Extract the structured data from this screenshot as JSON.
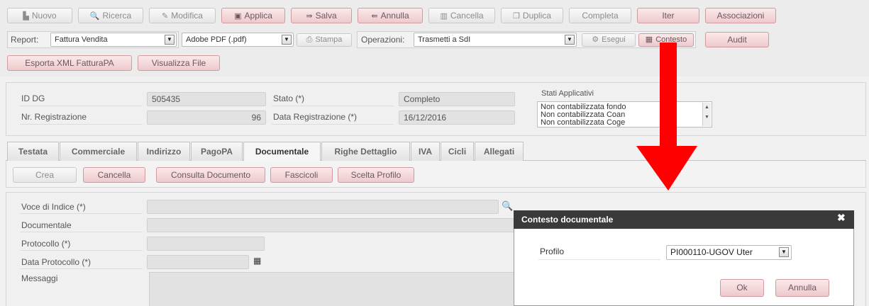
{
  "toolbar": {
    "nuovo": "Nuovo",
    "ricerca": "Ricerca",
    "modifica": "Modifica",
    "applica": "Applica",
    "salva": "Salva",
    "annulla": "Annulla",
    "cancella": "Cancella",
    "duplica": "Duplica",
    "completa": "Completa",
    "iter": "Iter",
    "associazioni": "Associazioni"
  },
  "report_bar": {
    "report_label": "Report:",
    "report_value": "Fattura Vendita",
    "format_value": "Adobe PDF (.pdf)",
    "stampa": "Stampa",
    "operazioni_label": "Operazioni:",
    "operazioni_value": "Trasmetti a SdI",
    "esegui": "Esegui",
    "contesto": "Contesto",
    "audit": "Audit"
  },
  "secondary_bar": {
    "esporta": "Esporta XML FatturaPA",
    "visualizza": "Visualizza File"
  },
  "header_form": {
    "id_dg_label": "ID DG",
    "id_dg_value": "505435",
    "nr_reg_label": "Nr. Registrazione",
    "nr_reg_value": "96",
    "stato_label": "Stato (*)",
    "stato_value": "Completo",
    "data_reg_label": "Data Registrazione (*)",
    "data_reg_value": "16/12/2016",
    "stati_label": "Stati Applicativi",
    "stati_items": [
      "Non contabilizzata fondo",
      "Non contabilizzata Coan",
      "Non contabilizzata Coge"
    ]
  },
  "tabs": [
    "Testata",
    "Commerciale",
    "Indirizzo",
    "PagoPA",
    "Documentale",
    "Righe Dettaglio",
    "IVA",
    "Cicli",
    "Allegati"
  ],
  "active_tab": "Documentale",
  "doc_toolbar": {
    "crea": "Crea",
    "cancella": "Cancella",
    "consulta": "Consulta Documento",
    "fascicoli": "Fascicoli",
    "scelta": "Scelta Profilo"
  },
  "doc_form": {
    "voce_label": "Voce di Indice (*)",
    "documentale_label": "Documentale",
    "protocollo_label": "Protocollo (*)",
    "data_protocollo_label": "Data Protocollo (*)",
    "messaggi_label": "Messaggi"
  },
  "dialog": {
    "title": "Contesto documentale",
    "profilo_label": "Profilo",
    "profilo_value": "PI000110-UGOV Uter",
    "ok": "Ok",
    "annulla": "Annulla"
  },
  "colors": {
    "pink_button": "#eec9cc",
    "dialog_header": "#3a3a3a",
    "arrow": "#ff0000"
  },
  "icons": [
    "new-doc-icon",
    "search-icon",
    "pencil-icon",
    "save-icon",
    "merge-icon",
    "cancel-icon",
    "trash-icon",
    "copy-icon",
    "printer-icon",
    "gear-icon",
    "context-icon",
    "calendar-icon",
    "close-icon"
  ]
}
